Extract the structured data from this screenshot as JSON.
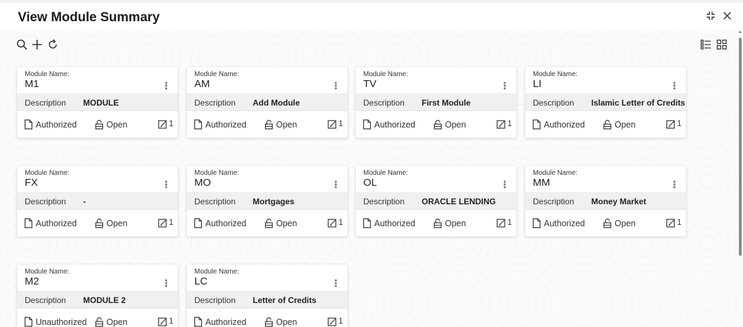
{
  "window": {
    "title": "View Module Summary"
  },
  "toolbar": {
    "icons": [
      "search-icon",
      "add-icon",
      "refresh-icon"
    ]
  },
  "view_switch": {
    "icons": [
      "list-view-icon",
      "grid-view-icon"
    ]
  },
  "cards": [
    {
      "module_label": "Module Name:",
      "module_name": "M1",
      "desc_label": "Description",
      "description": "MODULE",
      "status": "Authorized",
      "lock": "Open",
      "edit_count": "1"
    },
    {
      "module_label": "Module Name:",
      "module_name": "AM",
      "desc_label": "Description",
      "description": "Add Module",
      "status": "Authorized",
      "lock": "Open",
      "edit_count": "1"
    },
    {
      "module_label": "Module Name:",
      "module_name": "TV",
      "desc_label": "Description",
      "description": "First Module",
      "status": "Authorized",
      "lock": "Open",
      "edit_count": "1"
    },
    {
      "module_label": "Module Name:",
      "module_name": "LI",
      "desc_label": "Description",
      "description": "Islamic Letter of Credits",
      "status": "Authorized",
      "lock": "Open",
      "edit_count": "1"
    },
    {
      "module_label": "Module Name:",
      "module_name": "FX",
      "desc_label": "Description",
      "description": "-",
      "status": "Authorized",
      "lock": "Open",
      "edit_count": "1"
    },
    {
      "module_label": "Module Name:",
      "module_name": "MO",
      "desc_label": "Description",
      "description": "Mortgages",
      "status": "Authorized",
      "lock": "Open",
      "edit_count": "1"
    },
    {
      "module_label": "Module Name:",
      "module_name": "OL",
      "desc_label": "Description",
      "description": "ORACLE LENDING",
      "status": "Authorized",
      "lock": "Open",
      "edit_count": "1"
    },
    {
      "module_label": "Module Name:",
      "module_name": "MM",
      "desc_label": "Description",
      "description": "Money Market",
      "status": "Authorized",
      "lock": "Open",
      "edit_count": "1"
    },
    {
      "module_label": "Module Name:",
      "module_name": "M2",
      "desc_label": "Description",
      "description": "MODULE 2",
      "status": "Unauthorized",
      "lock": "Open",
      "edit_count": "1"
    },
    {
      "module_label": "Module Name:",
      "module_name": "LC",
      "desc_label": "Description",
      "description": "Letter of Credits",
      "status": "Authorized",
      "lock": "Open",
      "edit_count": "1"
    }
  ]
}
